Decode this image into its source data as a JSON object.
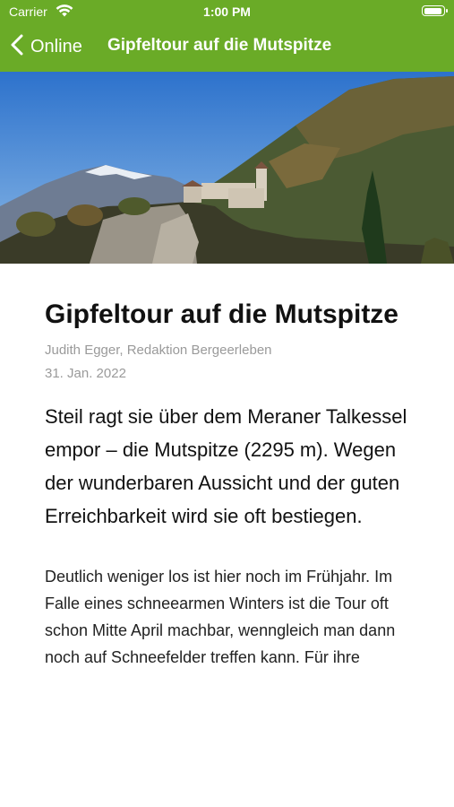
{
  "status_bar": {
    "carrier": "Carrier",
    "time": "1:00 PM",
    "icons": [
      "wifi-icon",
      "battery-icon"
    ]
  },
  "nav": {
    "back_label": "Online",
    "title": "Gipfeltour auf die Mutspitze",
    "back_icon": "chevron-left-icon"
  },
  "colors": {
    "accent": "#6aab27",
    "meta_text": "#9a9a9a"
  },
  "article": {
    "title": "Gipfeltour auf die Mutspitze",
    "author": "Judith Egger, Redaktion Bergeerleben",
    "date": "31. Jan. 2022",
    "lead": "Steil ragt sie über dem Meraner Talkessel empor – die Mutspitze (2295 m). Wegen der wunderbaren Aussicht und der guten Erreichbarkeit wird sie oft bestiegen.",
    "body": "Deutlich weniger los ist hier noch im Frühjahr. Im Falle eines schneearmen Winters ist die Tour oft schon Mitte April machbar, wenngleich man dann noch auf Schneefelder treffen kann. Für ihre"
  }
}
